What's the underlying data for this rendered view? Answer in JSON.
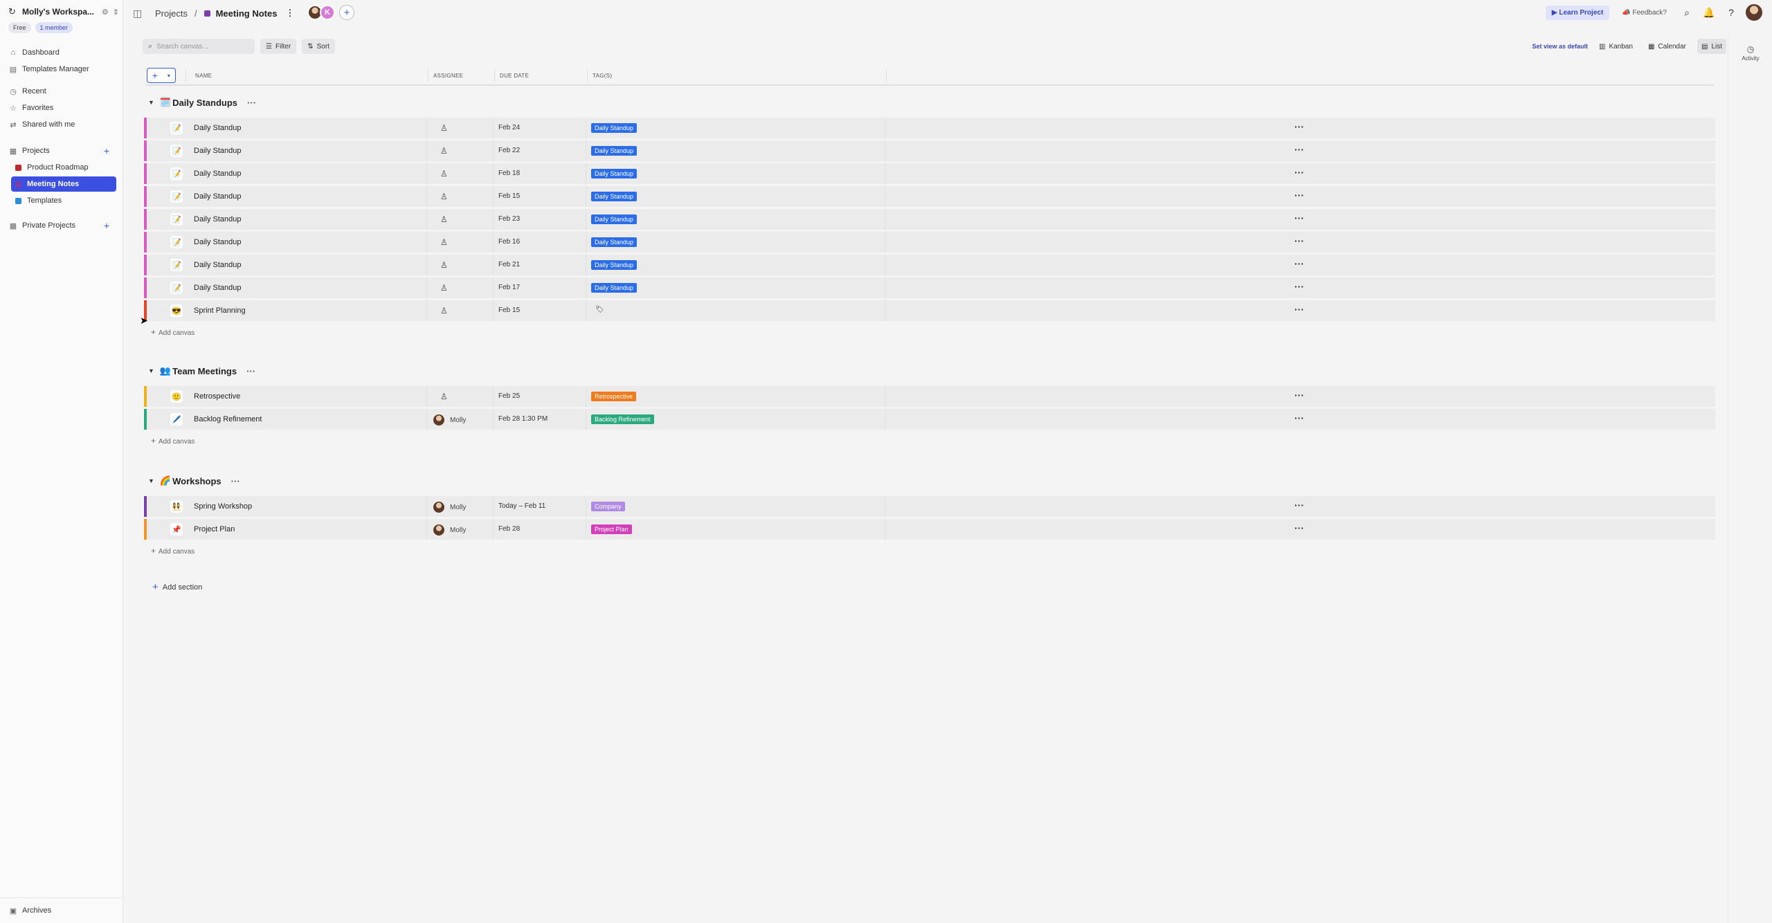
{
  "workspace": {
    "name": "Molly's Workspa...",
    "plan_badge": "Free",
    "members_badge": "1 member"
  },
  "nav": {
    "dashboard": "Dashboard",
    "templates_manager": "Templates Manager",
    "recent": "Recent",
    "favorites": "Favorites",
    "shared": "Shared with me",
    "projects": "Projects",
    "private_projects": "Private Projects",
    "archives": "Archives"
  },
  "projects": [
    {
      "label": "Product Roadmap",
      "color": "#c0282a"
    },
    {
      "label": "Meeting Notes",
      "color": "#7a3fa8"
    },
    {
      "label": "Templates",
      "color": "#2a8fd6"
    }
  ],
  "breadcrumb": {
    "root": "Projects",
    "separator": "/",
    "current": "Meeting Notes",
    "more": "⋮"
  },
  "collaborators": {
    "second_initial": "K",
    "add": "+"
  },
  "topbar": {
    "learn": "Learn Project",
    "feedback": "Feedback?"
  },
  "activity": {
    "label": "Activity"
  },
  "toolbar": {
    "search_placeholder": "Search canvas...",
    "filter": "Filter",
    "sort": "Sort"
  },
  "views": {
    "set_default": "Set view as default",
    "kanban": "Kanban",
    "calendar": "Calendar",
    "list": "List",
    "active": "List"
  },
  "columns": {
    "name": "NAME",
    "assignee": "ASSIGNEE",
    "due": "DUE DATE",
    "tags": "TAG(S)"
  },
  "tag_colors": {
    "Daily Standup": "#2b6de8",
    "Retrospective": "#f07b1c",
    "Backlog Refinement": "#2aa87e",
    "Company": "#b08be3",
    "Project Plan": "#d23fb8"
  },
  "sections": [
    {
      "emoji": "🗓️",
      "title": "Daily Standups",
      "more": "···",
      "add_canvas": "Add canvas",
      "rows": [
        {
          "icon": "📝",
          "name": "Daily Standup",
          "assignee": "",
          "due": "Feb 24",
          "tag": "Daily Standup",
          "stripe": "#d65ac0"
        },
        {
          "icon": "📝",
          "name": "Daily Standup",
          "assignee": "",
          "due": "Feb 22",
          "tag": "Daily Standup",
          "stripe": "#d65ac0"
        },
        {
          "icon": "📝",
          "name": "Daily Standup",
          "assignee": "",
          "due": "Feb 18",
          "tag": "Daily Standup",
          "stripe": "#d65ac0"
        },
        {
          "icon": "📝",
          "name": "Daily Standup",
          "assignee": "",
          "due": "Feb 15",
          "tag": "Daily Standup",
          "stripe": "#d65ac0"
        },
        {
          "icon": "📝",
          "name": "Daily Standup",
          "assignee": "",
          "due": "Feb 23",
          "tag": "Daily Standup",
          "stripe": "#d65ac0"
        },
        {
          "icon": "📝",
          "name": "Daily Standup",
          "assignee": "",
          "due": "Feb 16",
          "tag": "Daily Standup",
          "stripe": "#d65ac0"
        },
        {
          "icon": "📝",
          "name": "Daily Standup",
          "assignee": "",
          "due": "Feb 21",
          "tag": "Daily Standup",
          "stripe": "#d65ac0"
        },
        {
          "icon": "📝",
          "name": "Daily Standup",
          "assignee": "",
          "due": "Feb 17",
          "tag": "Daily Standup",
          "stripe": "#d65ac0"
        },
        {
          "icon": "😎",
          "name": "Sprint Planning",
          "assignee": "",
          "due": "Feb 15",
          "tag": "",
          "stripe": "#e0452a"
        }
      ]
    },
    {
      "emoji": "👥",
      "title": "Team Meetings",
      "more": "···",
      "add_canvas": "Add canvas",
      "rows": [
        {
          "icon": "🙂",
          "name": "Retrospective",
          "assignee": "",
          "due": "Feb 25",
          "tag": "Retrospective",
          "stripe": "#f0b21c"
        },
        {
          "icon": "🖊️",
          "name": "Backlog Refinement",
          "assignee": "Molly",
          "due": "Feb 28 1:30 PM",
          "tag": "Backlog Refinement",
          "stripe": "#2aa87e"
        }
      ]
    },
    {
      "emoji": "🌈",
      "title": "Workshops",
      "more": "···",
      "add_canvas": "Add canvas",
      "rows": [
        {
          "icon": "👯",
          "name": "Spring Workshop",
          "assignee": "Molly",
          "due": "Today – Feb 11",
          "tag": "Company",
          "stripe": "#7a3fa8"
        },
        {
          "icon": "📌",
          "name": "Project Plan",
          "assignee": "Molly",
          "due": "Feb 28",
          "tag": "Project Plan",
          "stripe": "#f0962a"
        }
      ]
    }
  ],
  "add_section": "Add section"
}
